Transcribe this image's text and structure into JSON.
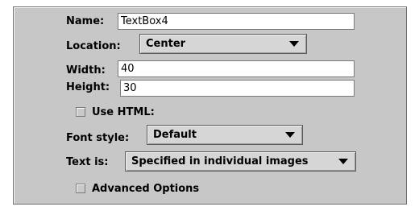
{
  "form": {
    "name": {
      "label": "Name:",
      "value": "TextBox4"
    },
    "location": {
      "label": "Location:",
      "selected": "Center"
    },
    "width": {
      "label": "Width:",
      "value": "40"
    },
    "height": {
      "label": "Height:",
      "value": "30"
    },
    "use_html": {
      "label": "Use HTML:",
      "checked": false
    },
    "font_style": {
      "label": "Font style:",
      "selected": "Default"
    },
    "text_is": {
      "label": "Text is:",
      "selected": "Specified in individual images"
    },
    "advanced": {
      "label": "Advanced Options",
      "checked": false
    }
  },
  "icons": {
    "dropdown_arrow": "chevron-down-icon",
    "checkbox": "checkbox-unchecked-icon"
  },
  "colors": {
    "panel_background": "#c7c7c7",
    "field_background": "#ffffff"
  }
}
